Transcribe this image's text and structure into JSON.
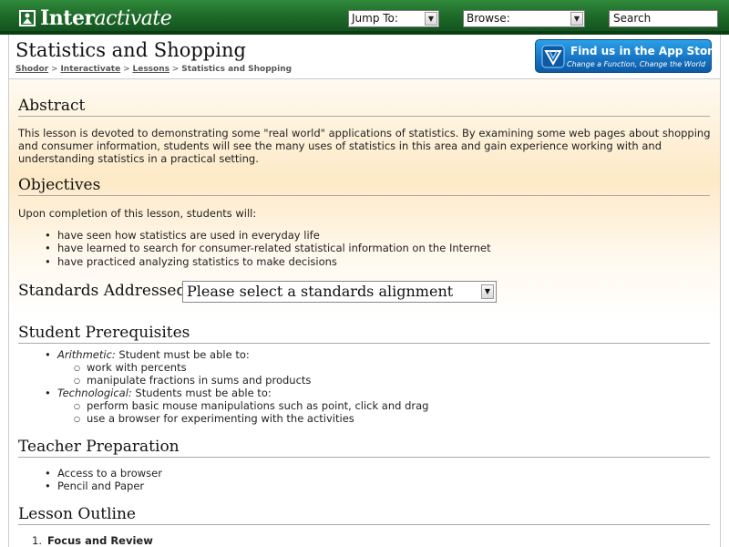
{
  "topbar": {
    "logo_prefix": "Inter",
    "logo_suffix": "activate",
    "jump_to": "Jump To:",
    "browse": "Browse:",
    "search_placeholder": "Search"
  },
  "header": {
    "title": "Statistics and Shopping",
    "breadcrumb": [
      "Shodor",
      "Interactivate",
      "Lessons"
    ],
    "breadcrumb_sep": ">",
    "breadcrumb_current": "Statistics and Shopping",
    "appstore_line1": "Find us in the App Store.",
    "appstore_line2": "Change a Function, Change the World"
  },
  "abstract": {
    "heading": "Abstract",
    "text": "This lesson is devoted to demonstrating some \"real world\" applications of statistics. By examining some web pages about shopping and consumer information, students will see the many uses of statistics in this area and gain experience working with and understanding statistics in a practical setting."
  },
  "objectives": {
    "heading": "Objectives",
    "intro": "Upon completion of this lesson, students will:",
    "items": [
      "have seen how statistics are used in everyday life",
      "have learned to search for consumer-related statistical information on the Internet",
      "have practiced analyzing statistics to make decisions"
    ]
  },
  "standards": {
    "label": "Standards Addressed:",
    "selected": "Please select a standards alignment"
  },
  "prerequisites": {
    "heading": "Student Prerequisites",
    "groups": [
      {
        "term": "Arithmetic:",
        "desc": " Student must be able to:",
        "items": [
          "work with percents",
          "manipulate fractions in sums and products"
        ]
      },
      {
        "term": "Technological:",
        "desc": " Students must be able to:",
        "items": [
          "perform basic mouse manipulations such as point, click and drag",
          "use a browser for experimenting with the activities"
        ]
      }
    ]
  },
  "teacher_prep": {
    "heading": "Teacher Preparation",
    "items": [
      "Access to a browser",
      "Pencil and Paper"
    ]
  },
  "outline": {
    "heading": "Lesson Outline",
    "items": [
      {
        "num": "1.",
        "text": "Focus and Review"
      }
    ]
  },
  "colors": {
    "green": "#1f6b2a",
    "appstore_blue": "#1773c2"
  }
}
